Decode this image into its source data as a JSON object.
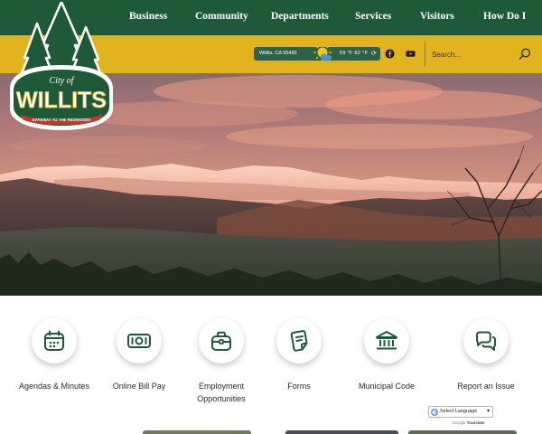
{
  "nav": {
    "items": [
      "Business",
      "Community",
      "Departments",
      "Services",
      "Visitors",
      "How Do I"
    ]
  },
  "logo": {
    "text_small": "City of",
    "text_main": "WILLITS",
    "tagline": "GATEWAY TO THE REDWOODS"
  },
  "weather": {
    "location": "Willits, CA 95490",
    "temps": "59 °F  82 °F"
  },
  "social": [
    "facebook-icon",
    "youtube-icon"
  ],
  "search": {
    "placeholder": "Search..."
  },
  "quick_links": [
    {
      "label": "Agendas & Minutes",
      "icon": "calendar-icon"
    },
    {
      "label": "Online Bill Pay",
      "icon": "bill-icon"
    },
    {
      "label": "Employment Opportunities",
      "icon": "briefcase-icon"
    },
    {
      "label": "Forms",
      "icon": "forms-icon"
    },
    {
      "label": "Municipal Code",
      "icon": "building-icon"
    },
    {
      "label": "Report an Issue",
      "icon": "chat-icon"
    }
  ],
  "translate": {
    "label": "Select Language",
    "powered_prefix": "Google",
    "powered_suffix": "Translate"
  },
  "colors": {
    "nav_green": "#1f5a38",
    "utility_gold": "#e2b21f",
    "logo_red": "#c0392b",
    "link_text": "#2b2b2b"
  }
}
